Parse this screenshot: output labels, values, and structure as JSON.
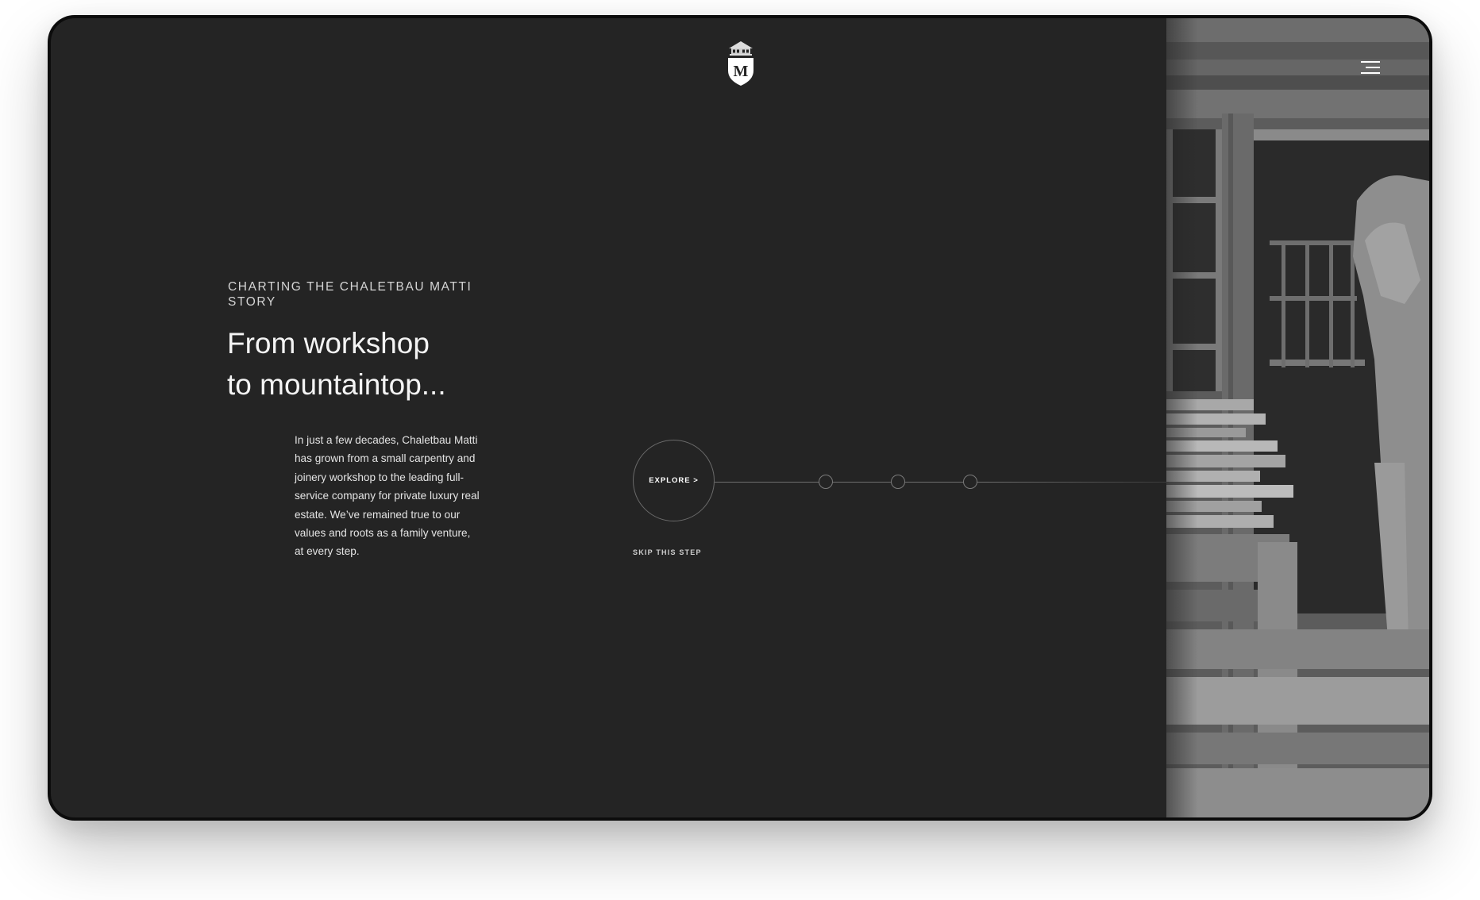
{
  "brand": {
    "logo_letter": "M"
  },
  "header": {
    "menu_icon": "hamburger-menu-icon"
  },
  "hero": {
    "eyebrow": "CHARTING THE CHALETBAU MATTI STORY",
    "headline_line1": "From workshop",
    "headline_line2": "to mountaintop...",
    "body": "In just a few decades, Chaletbau Matti has grown from a small carpentry and joinery workshop to the leading full-service company for private luxury real estate. We’ve remained true to our values and roots as a family venture, at every step."
  },
  "timeline": {
    "explore_label": "EXPLORE >",
    "skip_label": "SKIP THIS STEP",
    "step_count": 3
  },
  "colors": {
    "background": "#242424",
    "frame": "#0c0c0c",
    "text_primary": "#f4f4f4",
    "text_muted": "#d4d4d4",
    "line": "#6e6e6e"
  }
}
